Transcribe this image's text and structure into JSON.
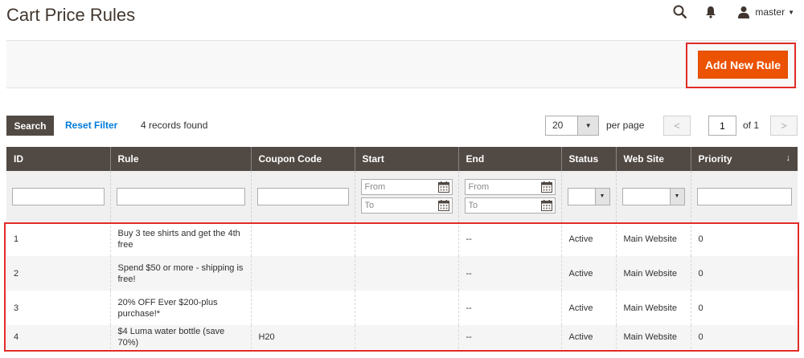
{
  "page": {
    "title": "Cart Price Rules"
  },
  "header": {
    "user_name": "master"
  },
  "actions": {
    "add_new_rule": "Add New Rule"
  },
  "toolbar": {
    "search_label": "Search",
    "reset_filter_label": "Reset Filter",
    "records_found": "4 records found",
    "per_page_value": "20",
    "per_page_label": "per page",
    "page_value": "1",
    "page_of": "of 1"
  },
  "grid": {
    "columns": [
      "ID",
      "Rule",
      "Coupon Code",
      "Start",
      "End",
      "Status",
      "Web Site",
      "Priority"
    ],
    "filters": {
      "from_placeholder": "From",
      "to_placeholder": "To"
    },
    "rows": [
      {
        "id": "1",
        "rule": "Buy 3 tee shirts and get the 4th free",
        "coupon": "",
        "start": "",
        "end": "--",
        "status": "Active",
        "website": "Main Website",
        "priority": "0"
      },
      {
        "id": "2",
        "rule": "Spend $50 or more - shipping is free!",
        "coupon": "",
        "start": "",
        "end": "--",
        "status": "Active",
        "website": "Main Website",
        "priority": "0"
      },
      {
        "id": "3",
        "rule": "20% OFF Ever $200-plus purchase!*",
        "coupon": "",
        "start": "",
        "end": "--",
        "status": "Active",
        "website": "Main Website",
        "priority": "0"
      },
      {
        "id": "4",
        "rule": "$4 Luma water bottle (save 70%)",
        "coupon": "H20",
        "start": "",
        "end": "--",
        "status": "Active",
        "website": "Main Website",
        "priority": "0"
      }
    ]
  },
  "colors": {
    "accent": "#eb5202",
    "header_bg": "#514943",
    "highlight": "#e02b27",
    "link": "#007bdb"
  }
}
